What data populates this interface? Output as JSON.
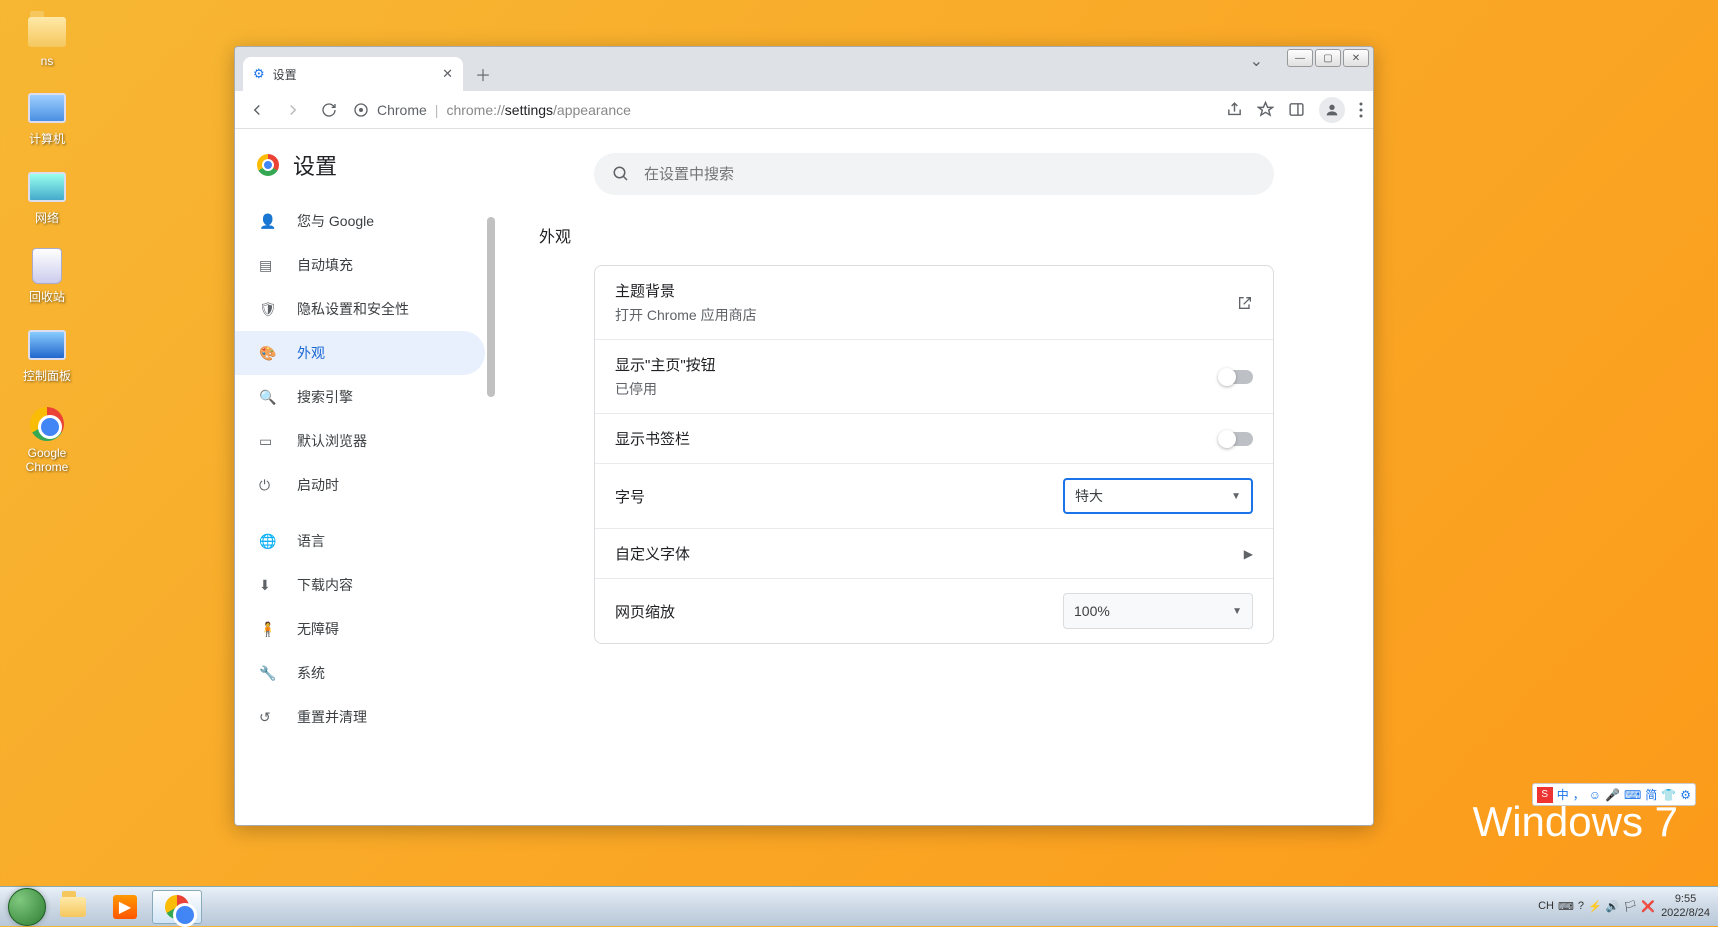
{
  "desktop": {
    "icons": [
      "ns",
      "计算机",
      "网络",
      "回收站",
      "控制面板",
      "Google Chrome"
    ]
  },
  "branding": "Windows 7",
  "ime": {
    "logo": "S",
    "items": [
      "中",
      "，",
      "☺",
      "🎤",
      "⌨",
      "简",
      "👕",
      "⚙"
    ]
  },
  "taskbar": {
    "tray_icons": [
      "CH",
      "⌨",
      "?",
      "⚡",
      "🔊",
      "🏳",
      "❌"
    ],
    "time": "9:55",
    "date": "2022/8/24"
  },
  "chrome": {
    "tab_title": "设置",
    "url_scheme": "Chrome",
    "url_prefix": "chrome://",
    "url_strong": "settings",
    "url_suffix": "/appearance",
    "settings_label": "设置",
    "search_placeholder": "在设置中搜索",
    "nav": {
      "you": "您与 Google",
      "autofill": "自动填充",
      "privacy": "隐私设置和安全性",
      "appearance": "外观",
      "search": "搜索引擎",
      "default": "默认浏览器",
      "startup": "启动时",
      "language": "语言",
      "downloads": "下载内容",
      "accessibility": "无障碍",
      "system": "系统",
      "reset": "重置并清理"
    },
    "section": {
      "title": "外观",
      "theme_title": "主题背景",
      "theme_sub": "打开 Chrome 应用商店",
      "home_title": "显示\"主页\"按钮",
      "home_sub": "已停用",
      "bookmarks": "显示书签栏",
      "fontsize_label": "字号",
      "fontsize_value": "特大",
      "custom_fonts": "自定义字体",
      "zoom_label": "网页缩放",
      "zoom_value": "100%"
    }
  }
}
